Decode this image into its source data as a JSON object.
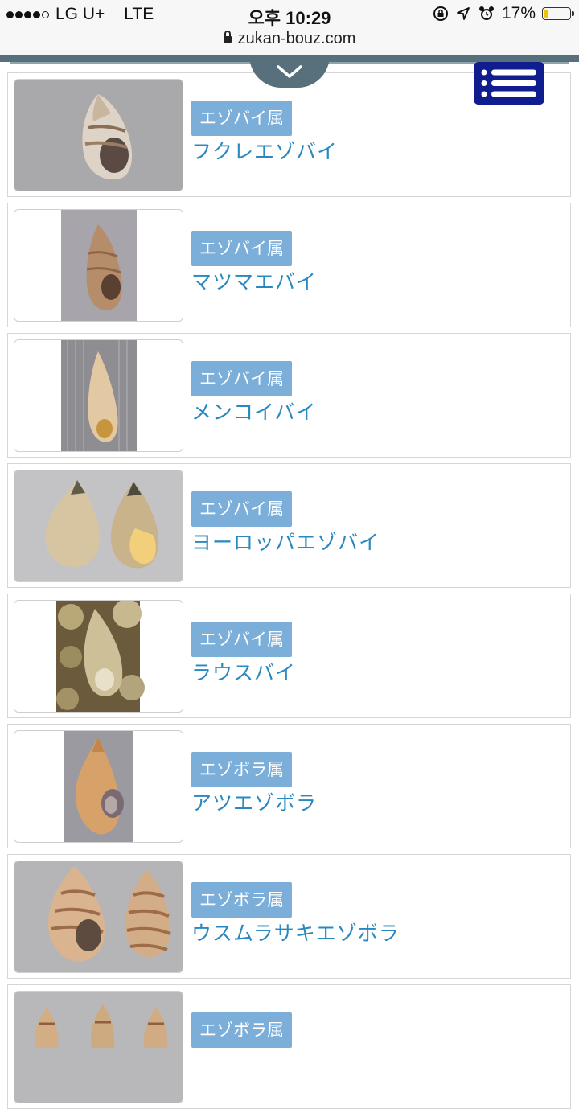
{
  "status_bar": {
    "carrier": "LG U+",
    "network": "LTE",
    "time": "오후 10:29",
    "battery": "17%",
    "battery_level": 0.17
  },
  "browser": {
    "url": "zukan-bouz.com"
  },
  "items": [
    {
      "genus": "エゾバイ属",
      "name": "フクレエゾバイ"
    },
    {
      "genus": "エゾバイ属",
      "name": "マツマエバイ"
    },
    {
      "genus": "エゾバイ属",
      "name": "メンコイバイ"
    },
    {
      "genus": "エゾバイ属",
      "name": "ヨーロッパエゾバイ"
    },
    {
      "genus": "エゾバイ属",
      "name": "ラウスバイ"
    },
    {
      "genus": "エゾボラ属",
      "name": "アツエゾボラ"
    },
    {
      "genus": "エゾボラ属",
      "name": "ウスムラサキエゾボラ"
    },
    {
      "genus": "エゾボラ属",
      "name": ""
    }
  ],
  "icons": {
    "scroll_toggle": "chevron-down-icon",
    "menu": "list-menu-icon"
  },
  "colors": {
    "genus_badge": "#7bafd9",
    "species_link": "#2a88c0",
    "menu_button": "#101d8e",
    "header_strip": "#57707c"
  }
}
